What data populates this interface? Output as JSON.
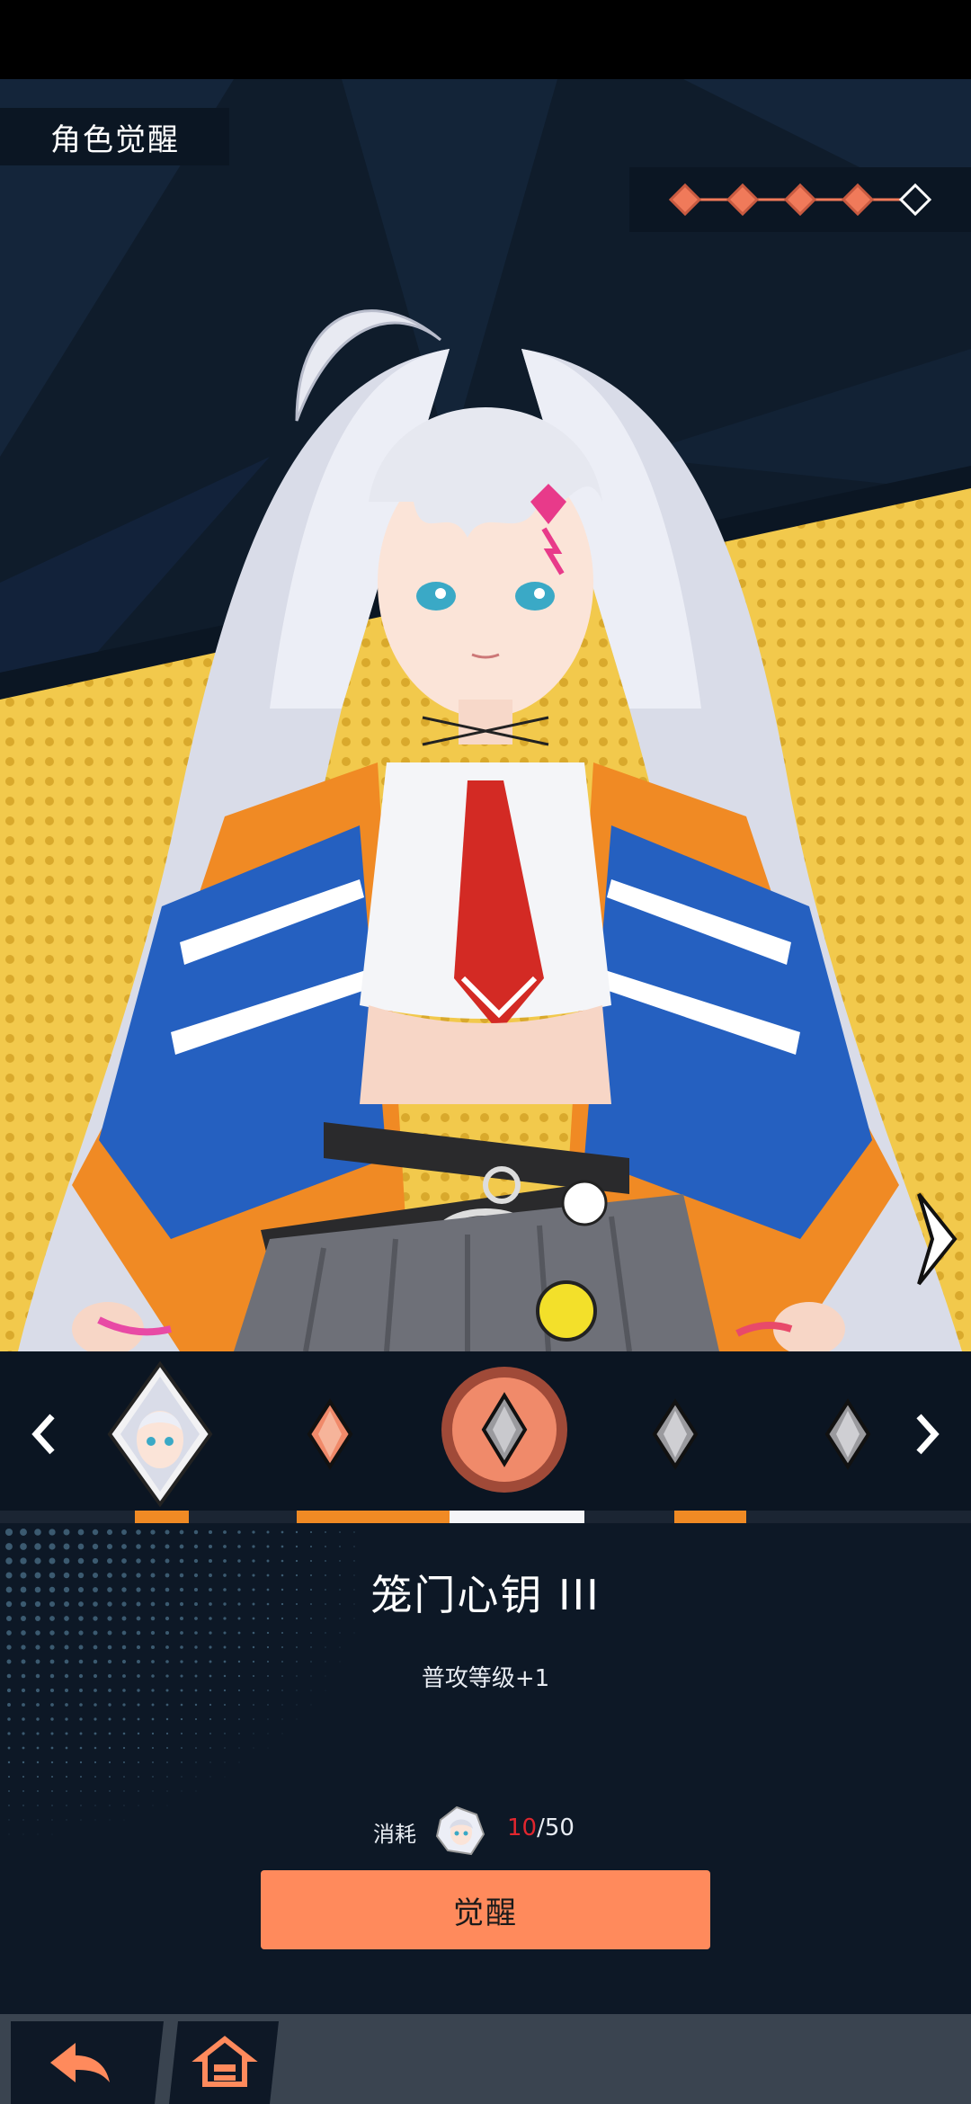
{
  "header": {
    "title": "角色觉醒"
  },
  "stars": {
    "filled": 4,
    "total": 5,
    "filled_color": "#f07a5a",
    "empty_color": "#ffffff"
  },
  "colors": {
    "accent": "#ff8a5c",
    "panel": "#0d1826",
    "highlight_red": "#e0262e"
  },
  "selector": {
    "nodes": [
      {
        "type": "portrait",
        "state": "unlocked"
      },
      {
        "type": "diamond",
        "state": "unlocked"
      },
      {
        "type": "diamond",
        "state": "selected"
      },
      {
        "type": "diamond",
        "state": "locked"
      },
      {
        "type": "diamond",
        "state": "locked"
      }
    ],
    "prev_icon": "chevron-left-icon",
    "next_icon": "chevron-right-icon"
  },
  "skill": {
    "title": "笼门心钥 III",
    "description": "普攻等级+1"
  },
  "cost": {
    "label": "消耗",
    "have": "10",
    "separator": "/",
    "total": "50",
    "icon": "character-fragment-icon"
  },
  "awaken_button": {
    "label": "觉醒"
  },
  "bottom_nav": {
    "back_icon": "back-arrow-icon",
    "home_icon": "home-icon"
  }
}
